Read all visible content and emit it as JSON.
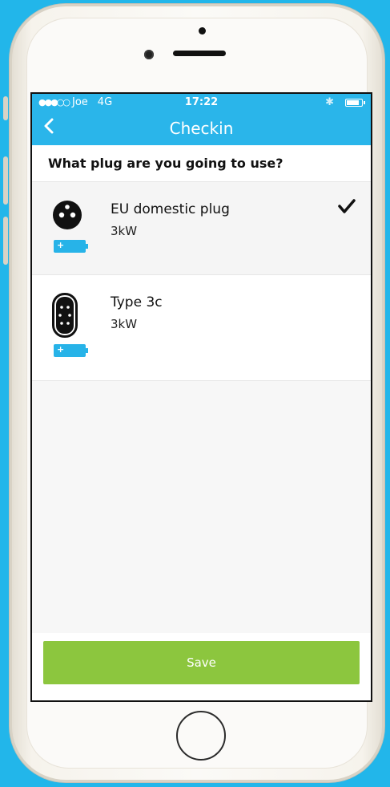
{
  "status_bar": {
    "carrier": "Joe",
    "network": "4G",
    "time": "17:22"
  },
  "nav": {
    "title": "Checkin",
    "back_icon": "chevron-left-icon"
  },
  "question": "What plug are you going to use?",
  "plugs": [
    {
      "name": "EU domestic plug",
      "power": "3kW",
      "selected": true,
      "icon": "eu-plug-icon"
    },
    {
      "name": "Type 3c",
      "power": "3kW",
      "selected": false,
      "icon": "type-3c-plug-icon"
    }
  ],
  "save_label": "Save",
  "colors": {
    "header": "#2ab5ea",
    "save_button": "#8cc63e",
    "background": "#22b6ea"
  }
}
